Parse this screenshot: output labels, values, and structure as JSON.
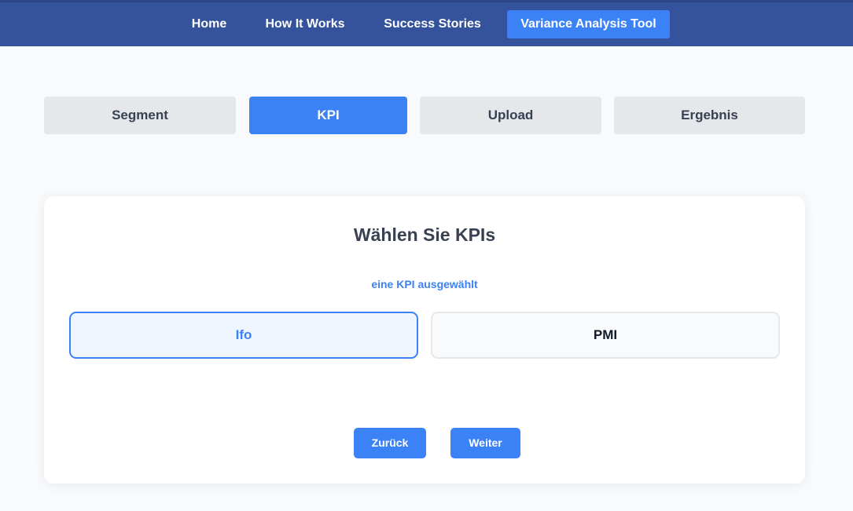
{
  "nav": {
    "items": [
      {
        "label": "Home"
      },
      {
        "label": "How It Works"
      },
      {
        "label": "Success Stories"
      },
      {
        "label": "Variance Analysis Tool",
        "active": true
      }
    ]
  },
  "steps": [
    {
      "label": "Segment",
      "active": false
    },
    {
      "label": "KPI",
      "active": true
    },
    {
      "label": "Upload",
      "active": false
    },
    {
      "label": "Ergebnis",
      "active": false
    }
  ],
  "kpi_selection": {
    "title": "Wählen Sie KPIs",
    "status": "eine KPI ausgewählt",
    "options": [
      {
        "label": "Ifo",
        "selected": true
      },
      {
        "label": "PMI",
        "selected": false
      }
    ],
    "back_label": "Zurück",
    "next_label": "Weiter"
  },
  "colors": {
    "nav_background": "#34539c",
    "accent": "#3b82f6",
    "step_inactive": "#e5e7eb",
    "page_background": "#f8fafc"
  }
}
